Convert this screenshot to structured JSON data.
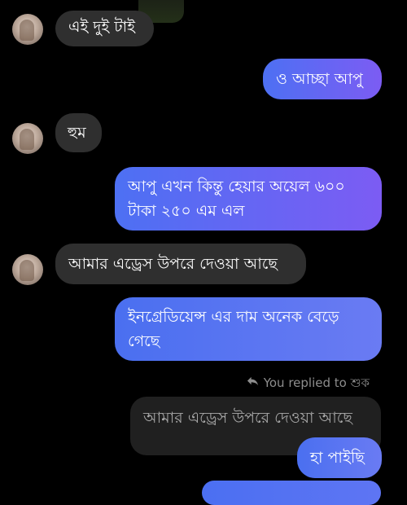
{
  "messages": [
    {
      "id": "m1",
      "direction": "incoming",
      "text": "এই দুই টাই"
    },
    {
      "id": "m2",
      "direction": "outgoing",
      "text": "ও আচ্ছা আপু"
    },
    {
      "id": "m3",
      "direction": "incoming",
      "text": "হুম"
    },
    {
      "id": "m4",
      "direction": "outgoing",
      "text": "আপু এখন কিন্তু হেয়ার অয়েল ৬০০ টাকা ২৫০ এম এল"
    },
    {
      "id": "m5",
      "direction": "incoming",
      "text": "আমার এড্রেস উপরে দেওয়া আছে"
    },
    {
      "id": "m6",
      "direction": "outgoing",
      "text": "ইনগ্রেডিয়েন্স এর দাম অনেক বেড়ে গেছে"
    }
  ],
  "reply": {
    "label": "You replied to শুক",
    "quoted_text": "আমার এড্রেস উপরে দেওয়া আছে",
    "text": "হা পাইছি"
  },
  "colors": {
    "background": "#000000",
    "incoming_bubble": "#2f2f2f",
    "outgoing_gradient_start": "#4d70f3",
    "outgoing_gradient_end": "#7c5cf3",
    "meta_text": "#8d8d8d"
  },
  "icons": {
    "reply": "reply-arrow-icon"
  }
}
